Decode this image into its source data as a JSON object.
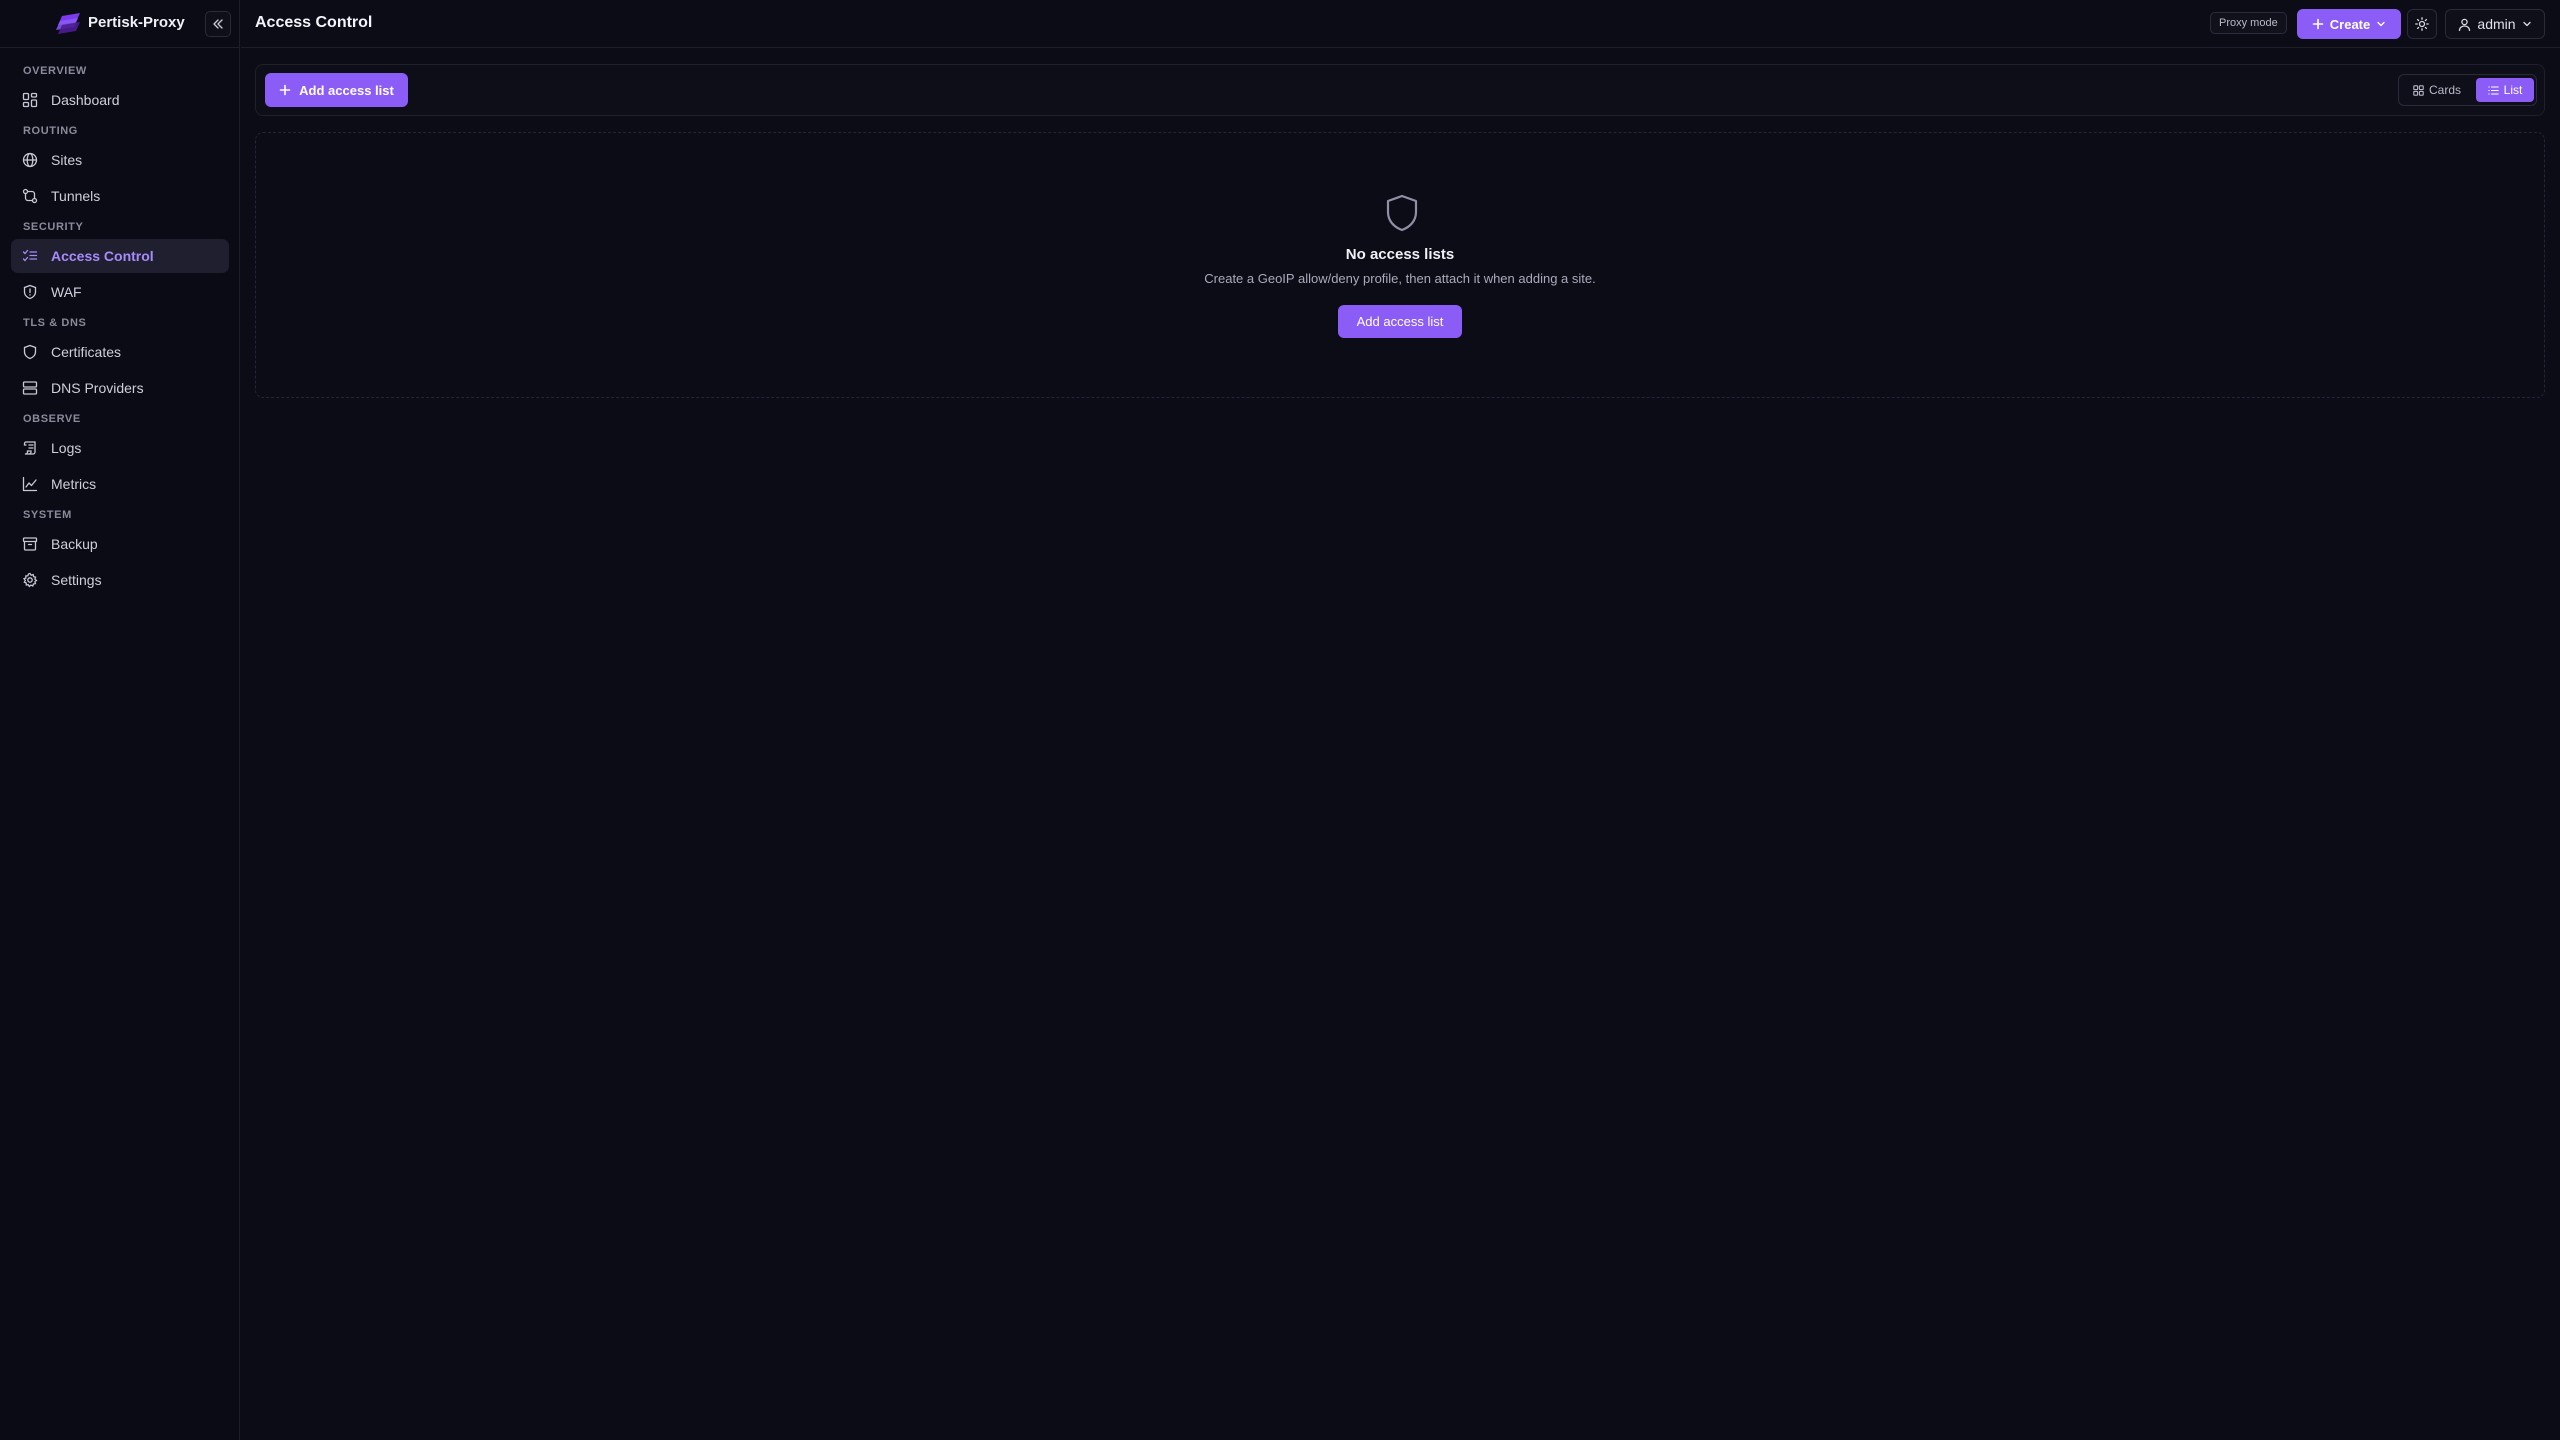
{
  "app": {
    "name": "Pertisk-Proxy"
  },
  "header": {
    "title": "Access Control",
    "mode_badge": "Proxy mode",
    "create_label": "Create",
    "user_label": "admin"
  },
  "sidebar": {
    "sections": [
      {
        "label": "OVERVIEW",
        "items": [
          {
            "label": "Dashboard",
            "icon": "dashboard-icon"
          }
        ]
      },
      {
        "label": "ROUTING",
        "items": [
          {
            "label": "Sites",
            "icon": "globe-icon"
          },
          {
            "label": "Tunnels",
            "icon": "route-icon"
          }
        ]
      },
      {
        "label": "SECURITY",
        "items": [
          {
            "label": "Access Control",
            "icon": "list-filter-icon",
            "active": true
          },
          {
            "label": "WAF",
            "icon": "shield-alert-icon"
          }
        ]
      },
      {
        "label": "TLS & DNS",
        "items": [
          {
            "label": "Certificates",
            "icon": "shield-icon"
          },
          {
            "label": "DNS Providers",
            "icon": "server-icon"
          }
        ]
      },
      {
        "label": "OBSERVE",
        "items": [
          {
            "label": "Logs",
            "icon": "scroll-icon"
          },
          {
            "label": "Metrics",
            "icon": "chart-line-icon"
          }
        ]
      },
      {
        "label": "SYSTEM",
        "items": [
          {
            "label": "Backup",
            "icon": "archive-icon"
          },
          {
            "label": "Settings",
            "icon": "gear-icon"
          }
        ]
      }
    ]
  },
  "toolbar": {
    "add_label": "Add access list",
    "view_cards": "Cards",
    "view_list": "List",
    "active_view": "List"
  },
  "empty_state": {
    "title": "No access lists",
    "description": "Create a GeoIP allow/deny profile, then attach it when adding a site.",
    "button_label": "Add access list",
    "icon": "shield-icon"
  },
  "colors": {
    "accent": "#8b5cf6",
    "accent_text": "#a78bfa",
    "background": "#0c0c16"
  }
}
